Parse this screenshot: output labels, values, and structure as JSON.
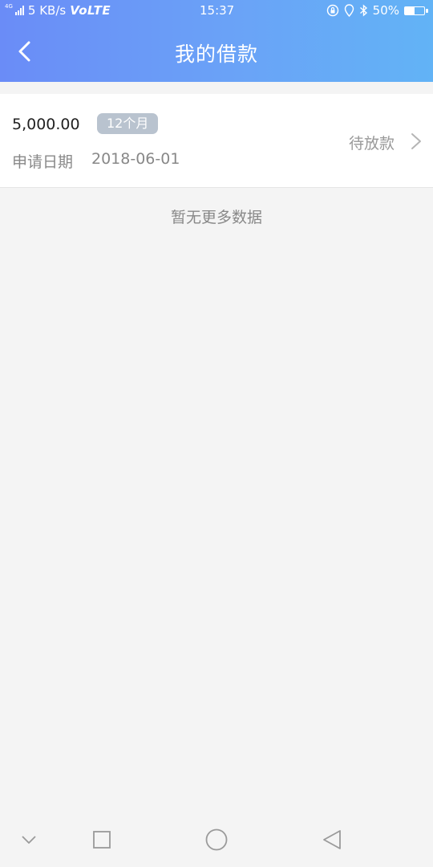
{
  "status_bar": {
    "network_tag": "4G",
    "speed": "5 KB/s",
    "volte": "VoLTE",
    "time": "15:37",
    "battery": "50%",
    "battery_level": 0.5,
    "icons": [
      "signal-icon",
      "rotation-lock-icon",
      "location-icon",
      "bluetooth-icon",
      "battery-icon"
    ]
  },
  "header": {
    "title": "我的借款",
    "back_icon": "back-arrow-icon"
  },
  "loans": [
    {
      "amount": "5,000.00",
      "term": "12个月",
      "date_label": "申请日期",
      "date": "2018-06-01",
      "status": "待放款"
    }
  ],
  "footer_text": "暂无更多数据",
  "system_nav": [
    "chevron-down-icon",
    "recents-square-icon",
    "home-circle-icon",
    "back-triangle-icon"
  ],
  "colors": {
    "header_start": "#6a8cf7",
    "header_end": "#62b3f6",
    "badge": "#b9c3cf",
    "background": "#f4f4f4"
  }
}
